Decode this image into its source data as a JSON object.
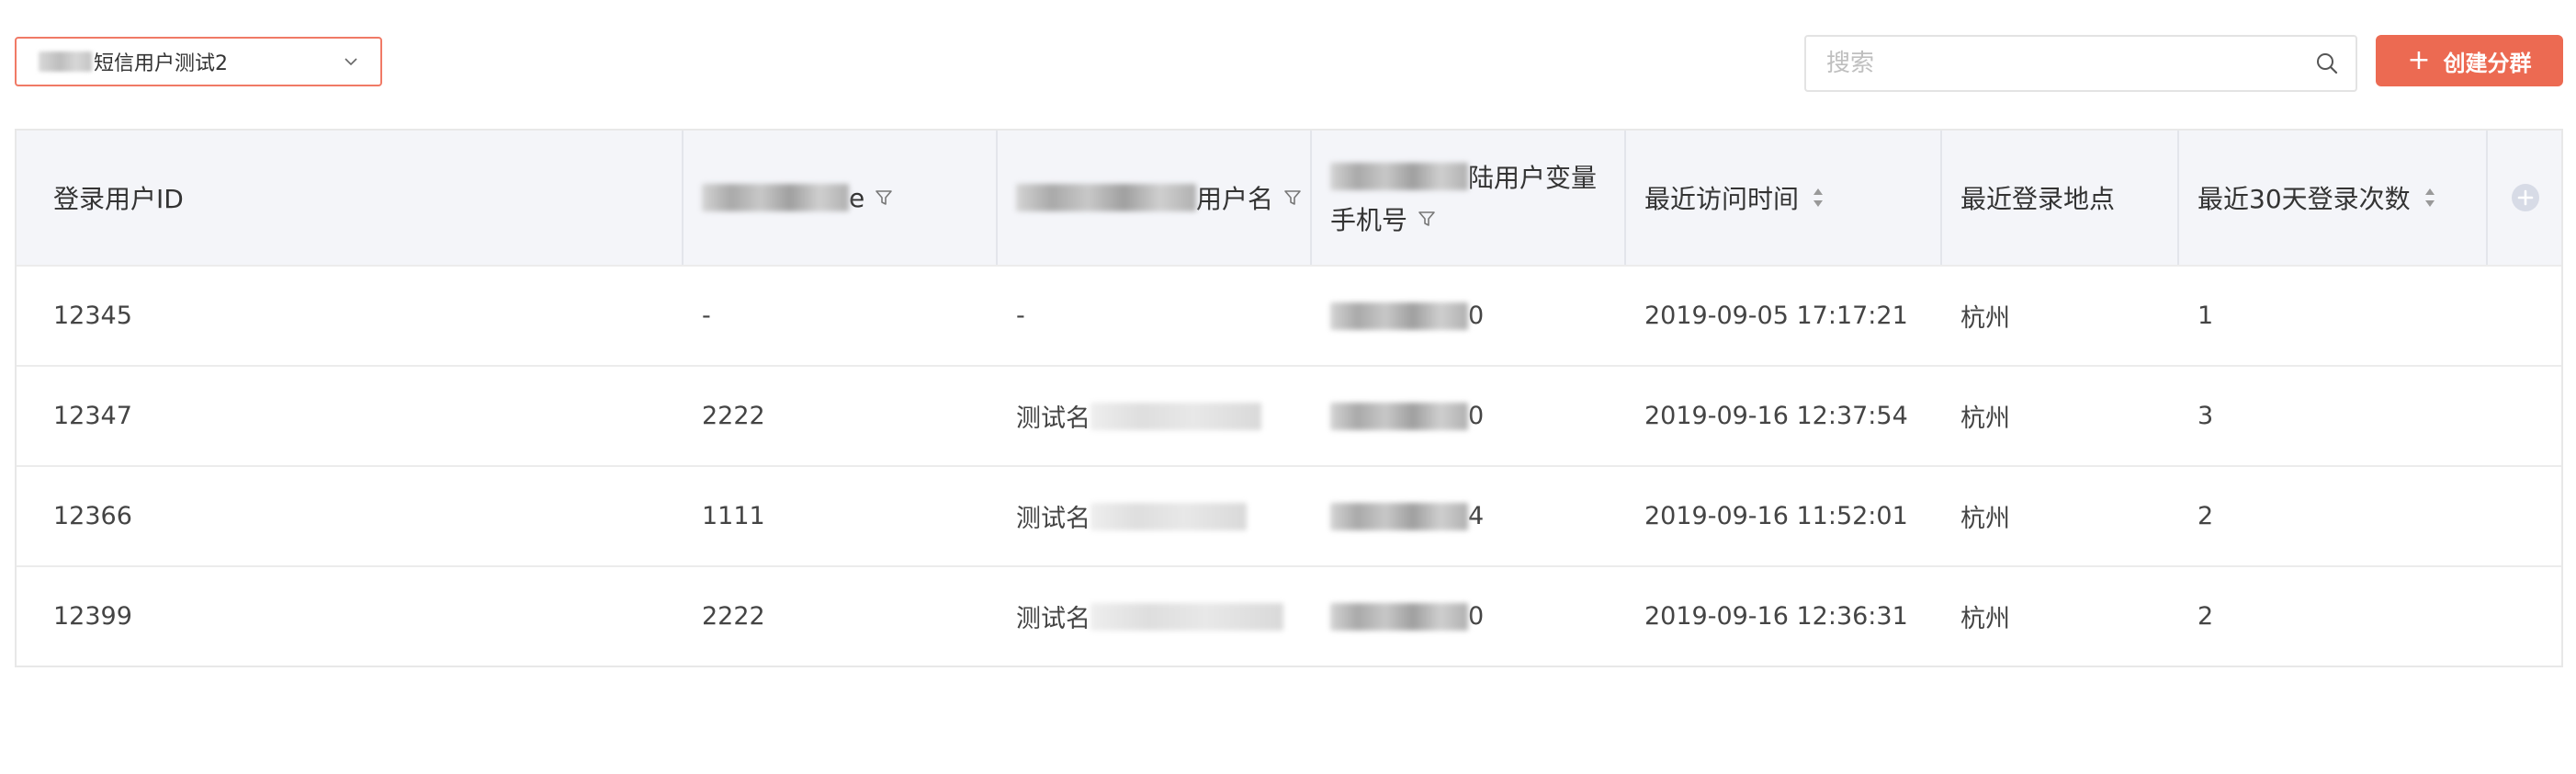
{
  "toolbar": {
    "group_select_value": "短信用户测试2",
    "search_placeholder": "搜索",
    "create_button_label": "创建分群",
    "create_button_icon": "plus-icon",
    "accent_color": "#ec6a52"
  },
  "table": {
    "headers": {
      "user_id": "登录用户ID",
      "col2_suffix": "e",
      "col3_suffix": "用户名",
      "col4_line1_suffix": "陆用户变量",
      "col4_line2": "手机号",
      "last_visit": "最近访问时间",
      "last_location": "最近登录地点",
      "login_count": "最近30天登录次数"
    },
    "rows": [
      {
        "user_id": "12345",
        "col2": "-",
        "col3": "-",
        "col4_suffix": "0",
        "last_visit": "2019-09-05 17:17:21",
        "location": "杭州",
        "count": "1"
      },
      {
        "user_id": "12347",
        "col2": "2222",
        "col3": "测试名",
        "col4_suffix": "0",
        "last_visit": "2019-09-16 12:37:54",
        "location": "杭州",
        "count": "3"
      },
      {
        "user_id": "12366",
        "col2": "1111",
        "col3": "测试名",
        "col4_suffix": "4",
        "last_visit": "2019-09-16 11:52:01",
        "location": "杭州",
        "count": "2"
      },
      {
        "user_id": "12399",
        "col2": "2222",
        "col3": "测试名",
        "col4_suffix": "0",
        "last_visit": "2019-09-16 12:36:31",
        "location": "杭州",
        "count": "2"
      }
    ]
  }
}
